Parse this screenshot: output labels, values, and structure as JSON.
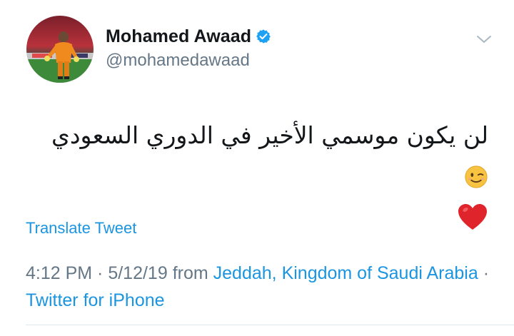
{
  "user": {
    "display_name": "Mohamed Awaad",
    "handle": "@mohamedawaad",
    "verified": true,
    "verified_color": "#1da1f2"
  },
  "tweet": {
    "text": "لن يكون موسمي الأخير في الدوري السعودي",
    "emojis": [
      "winking-face",
      "red-heart"
    ]
  },
  "actions": {
    "translate_label": "Translate Tweet"
  },
  "meta": {
    "time": "4:12 PM",
    "separator1": " · ",
    "date": "5/12/19",
    "from_word": " from ",
    "location": "Jeddah, Kingdom of Saudi Arabia",
    "separator2": " · ",
    "source": "Twitter for iPhone"
  },
  "colors": {
    "link": "#1b95e0",
    "secondary_text": "#657786",
    "primary_text": "#14171a"
  }
}
